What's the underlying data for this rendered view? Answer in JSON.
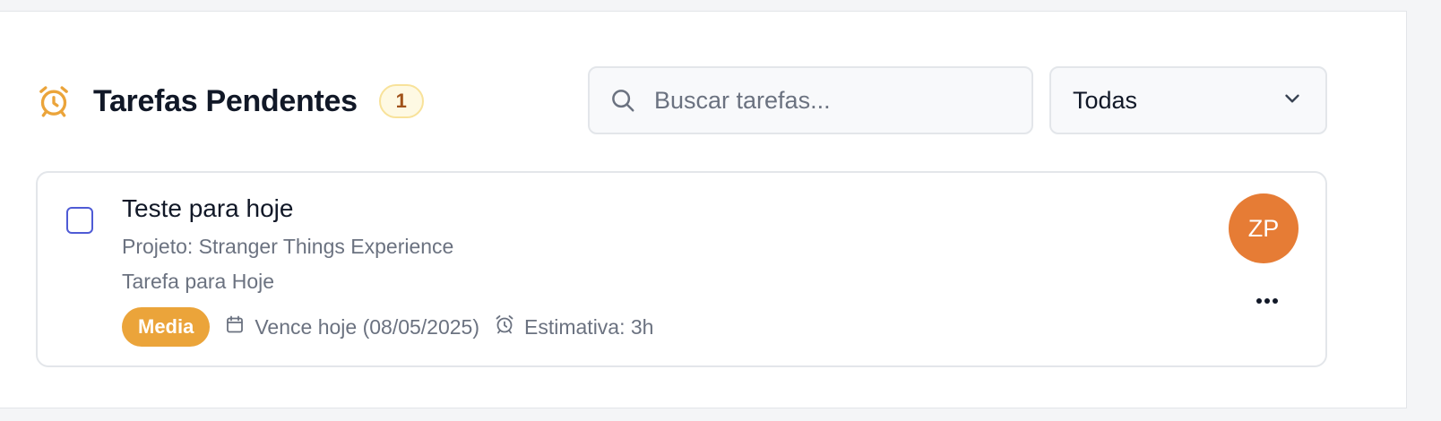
{
  "header": {
    "icon": "alarm-clock-icon",
    "title": "Tarefas Pendentes",
    "count": "1"
  },
  "search": {
    "icon": "search-icon",
    "placeholder": "Buscar tarefas...",
    "value": ""
  },
  "filter": {
    "selected": "Todas",
    "icon": "chevron-down-icon"
  },
  "task": {
    "checked": false,
    "title": "Teste para hoje",
    "project": "Projeto: Stranger Things Experience",
    "description": "Tarefa para Hoje",
    "priority": "Media",
    "due": "Vence hoje (08/05/2025)",
    "estimate": "Estimativa: 3h",
    "assignee_initials": "ZP",
    "more_icon": "more-horizontal-icon"
  },
  "colors": {
    "accent_orange": "#eba43a",
    "avatar": "#e67c35",
    "badge_bg": "#fef9e3",
    "checkbox": "#4f5bd5"
  }
}
